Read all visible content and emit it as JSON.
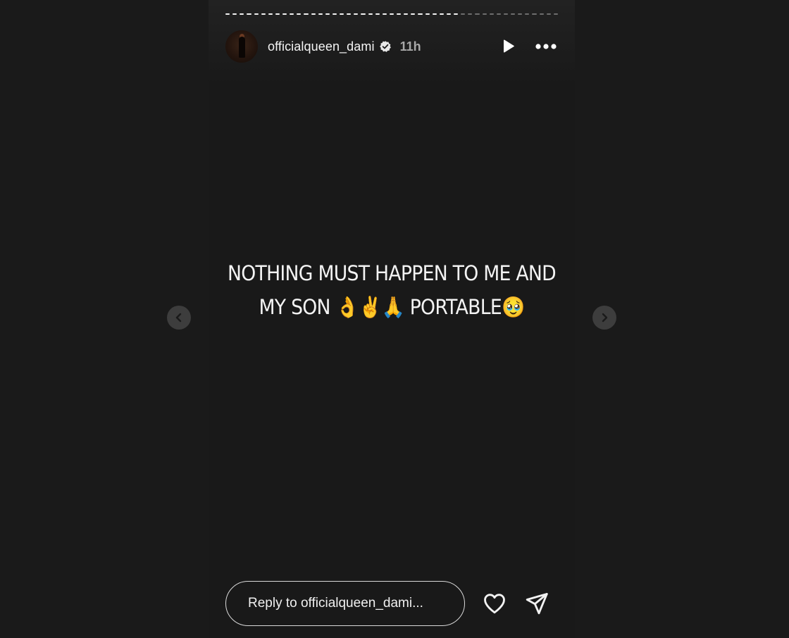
{
  "story": {
    "progress": {
      "segments_total": 47,
      "segments_viewed": 33
    },
    "user": {
      "username": "officialqueen_dami",
      "verified": true,
      "time_ago": "11h"
    },
    "caption": {
      "line1": "NOTHING MUST HAPPEN TO ME AND",
      "line2": "MY SON 👌✌️🙏  PORTABLE🥹"
    },
    "reply": {
      "placeholder": "Reply to officialqueen_dami..."
    }
  },
  "icons": {
    "play": "play-icon",
    "more": "more-options-icon",
    "verified": "verified-badge-icon",
    "prev": "chevron-left-icon",
    "next": "chevron-right-icon",
    "like": "heart-icon",
    "share": "paper-plane-icon"
  },
  "colors": {
    "page_background": "#1a1a1a",
    "story_background": "#191919",
    "text": "#f5f5f5",
    "muted_text": "#a8a8a8",
    "nav_button": "#3d3d3d"
  }
}
